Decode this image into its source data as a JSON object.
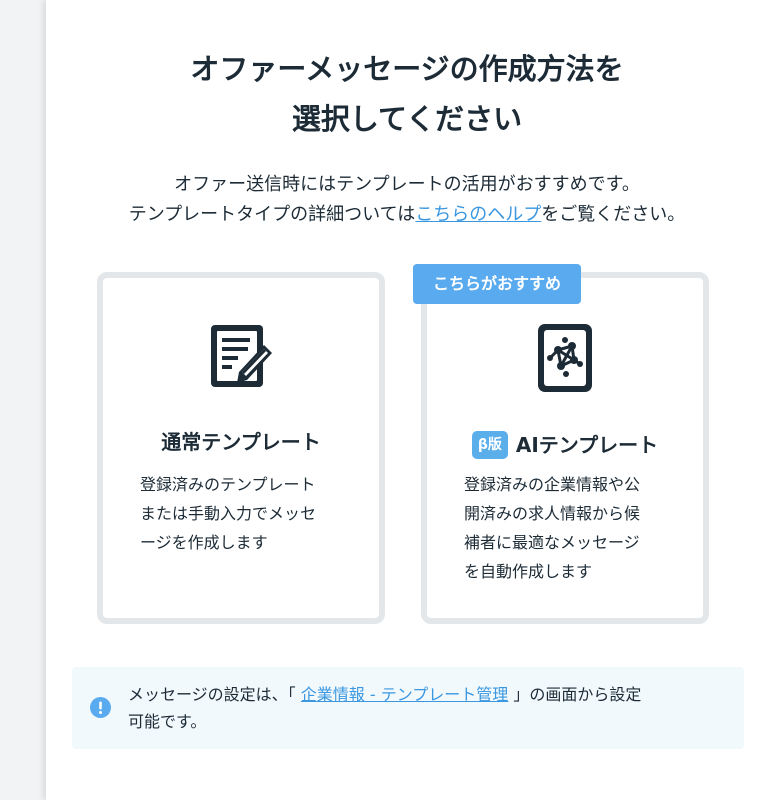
{
  "header": {
    "title_line1": "オファーメッセージの作成方法を",
    "title_line2": "選択してください"
  },
  "description": {
    "line1": "オファー送信時にはテンプレートの活用がおすすめです。",
    "line2_prefix": "テンプレートタイプの詳細ついては",
    "help_link": "こちらのヘルプ",
    "line2_suffix": "をご覧ください。"
  },
  "cards": {
    "normal": {
      "icon": "document-edit-icon",
      "title": "通常テンプレート",
      "desc": [
        "登録済みのテンプレート",
        "または手動入力でメッセ",
        "ージを作成します"
      ]
    },
    "ai": {
      "icon": "ai-network-icon",
      "badge": "こちらがおすすめ",
      "beta": "β版",
      "title": "AIテンプレート",
      "desc": [
        "登録済みの企業情報や公",
        "開済みの求人情報から候",
        "補者に最適なメッセージ",
        "を自動作成します"
      ]
    }
  },
  "notice": {
    "icon": "exclamation-icon",
    "prefix": "メッセージの設定は、「",
    "link": "企業情報 - テンプレート管理",
    "suffix": "」の画面から設定",
    "line2": "可能です。"
  },
  "colors": {
    "accent": "#59aaee",
    "link": "#3a97e0",
    "text": "#1c2b36",
    "card_border": "#e3e7ea",
    "notice_bg": "#f2f9fd"
  }
}
